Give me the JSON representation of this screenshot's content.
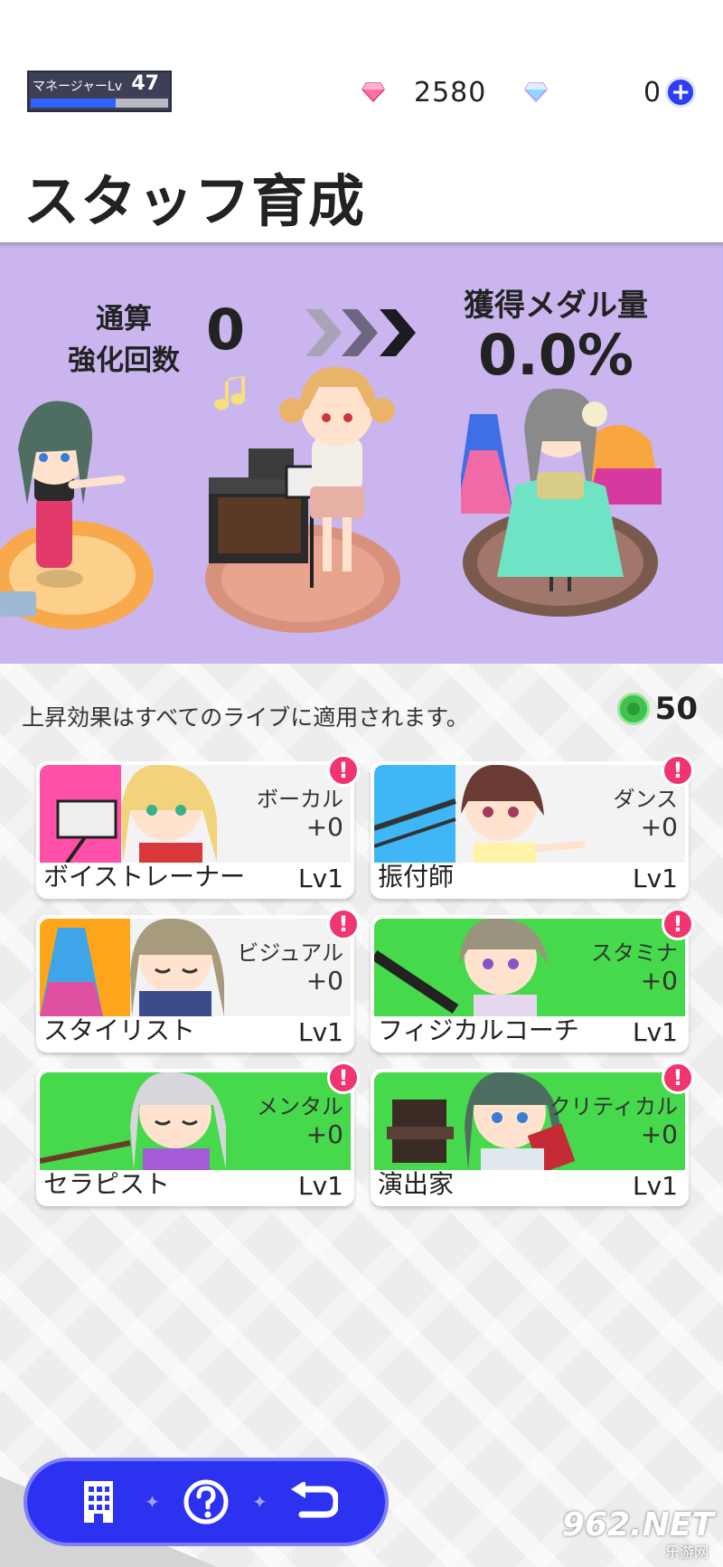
{
  "header": {
    "manager_label": "マネージャーLv",
    "manager_level": "47",
    "manager_exp_fraction": 0.62,
    "paid_gems": "2580",
    "free_gems": "0",
    "plus_label": "+"
  },
  "page_title": "スタッフ育成",
  "banner": {
    "total_label": "通算\n強化回数",
    "total_count": "0",
    "medal_label": "獲得メダル量",
    "medal_percent": "0.0%"
  },
  "info": {
    "note": "上昇効果はすべてのライブに適用されます。",
    "medal_count": "50"
  },
  "staff": [
    {
      "name": "ボイストレーナー",
      "level": "Lv1",
      "stat": "ボーカル",
      "bonus": "+0",
      "alert": "!",
      "art_color": "#ff4fa6"
    },
    {
      "name": "振付師",
      "level": "Lv1",
      "stat": "ダンス",
      "bonus": "+0",
      "alert": "!",
      "art_color": "#3fb6f5"
    },
    {
      "name": "スタイリスト",
      "level": "Lv1",
      "stat": "ビジュアル",
      "bonus": "+0",
      "alert": "!",
      "art_color": "#ffa51a"
    },
    {
      "name": "フィジカルコーチ",
      "level": "Lv1",
      "stat": "スタミナ",
      "bonus": "+0",
      "alert": "!",
      "art_color": "#45d94b"
    },
    {
      "name": "セラピスト",
      "level": "Lv1",
      "stat": "メンタル",
      "bonus": "+0",
      "alert": "!",
      "art_color": "#45d94b"
    },
    {
      "name": "演出家",
      "level": "Lv1",
      "stat": "クリティカル",
      "bonus": "+0",
      "alert": "!",
      "art_color": "#45d94b"
    }
  ],
  "watermark": {
    "main": "962.NET",
    "sub": "乐游网"
  },
  "colors": {
    "banner_bg": "#cab5ef",
    "nav_bg": "#2d31f0",
    "alert": "#f0356f"
  }
}
